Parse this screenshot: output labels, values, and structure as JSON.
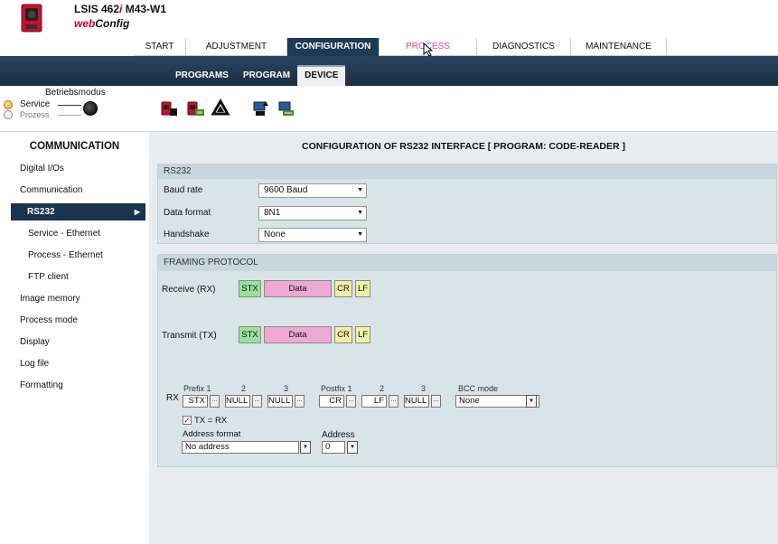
{
  "header": {
    "model_prefix": "LSIS 462",
    "model_italic": "i",
    "model_suffix": " M43-W1",
    "brand_web": "web",
    "brand_config": "Config"
  },
  "main_tabs": [
    {
      "label": "START"
    },
    {
      "label": "ADJUSTMENT"
    },
    {
      "label": "CONFIGURATION"
    },
    {
      "label": "PROCESS"
    },
    {
      "label": "DIAGNOSTICS"
    },
    {
      "label": "MAINTENANCE"
    }
  ],
  "sub_tabs": [
    {
      "label": "PROGRAMS"
    },
    {
      "label": "PROGRAM"
    },
    {
      "label": "DEVICE"
    }
  ],
  "mode": {
    "title": "Betriebsmodus",
    "service": "Service",
    "prozess": "Prozess"
  },
  "toolbar": {
    "icons": [
      "load-device-icon",
      "save-device-icon",
      "recycle-icon",
      "upload-pc-icon",
      "download-pc-icon"
    ]
  },
  "sidebar": {
    "title": "COMMUNICATION",
    "items": [
      {
        "label": "Digital I/Os"
      },
      {
        "label": "Communication"
      },
      {
        "label": "RS232"
      },
      {
        "label": "Service - Ethernet"
      },
      {
        "label": "Process - Ethernet"
      },
      {
        "label": "FTP client"
      },
      {
        "label": "Image memory"
      },
      {
        "label": "Process mode"
      },
      {
        "label": "Display"
      },
      {
        "label": "Log file"
      },
      {
        "label": "Formatting"
      }
    ]
  },
  "content": {
    "title": "CONFIGURATION OF RS232 INTERFACE   [ PROGRAM: CODE-READER ]",
    "rs232": {
      "header": "RS232",
      "baud_label": "Baud rate",
      "baud_value": "9600 Baud",
      "format_label": "Data format",
      "format_value": "8N1",
      "handshake_label": "Handshake",
      "handshake_value": "None"
    },
    "framing": {
      "header": "FRAMING PROTOCOL",
      "receive_label": "Receive (RX)",
      "transmit_label": "Transmit (TX)",
      "stx": "STX",
      "data": "Data",
      "cr": "CR",
      "lf": "LF",
      "rx_label": "RX",
      "prefix1_cap": "Prefix 1",
      "prefix2_cap": "2",
      "prefix3_cap": "3",
      "postfix1_cap": "Postfix 1",
      "postfix2_cap": "2",
      "postfix3_cap": "3",
      "bcc_cap": "BCC mode",
      "prefix1": "STX",
      "prefix2": "NULL",
      "prefix3": "NULL",
      "postfix1": "CR",
      "postfix2": "LF",
      "postfix3": "NULL",
      "bcc_value": "None",
      "tx_eq_rx": "TX = RX",
      "addr_format_cap": "Address format",
      "addr_format_value": "No address",
      "address_cap": "Address",
      "address_value": "0"
    }
  }
}
